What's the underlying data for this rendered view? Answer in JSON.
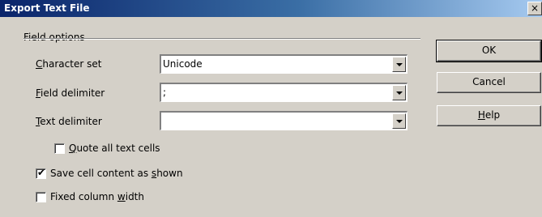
{
  "window": {
    "title": "Export Text File",
    "close_glyph": "×"
  },
  "field_options": {
    "legend": "Field options",
    "character_set": {
      "label_mnemonic": "C",
      "label_rest": "haracter set",
      "value": "Unicode"
    },
    "field_delimiter": {
      "label_mnemonic": "F",
      "label_rest": "ield delimiter",
      "value": ";"
    },
    "text_delimiter": {
      "label_mnemonic": "T",
      "label_rest": "ext delimiter",
      "value": ""
    }
  },
  "checkboxes": {
    "quote_all": {
      "label_mnemonic": "Q",
      "label_rest": "uote all text cells",
      "checked": false
    },
    "save_as_shown": {
      "label_pre": "Save cell content as ",
      "label_mnemonic": "s",
      "label_rest": "hown",
      "checked": true
    },
    "fixed_width": {
      "label_pre": "Fixed column ",
      "label_mnemonic": "w",
      "label_rest": "idth",
      "checked": false
    },
    "check_glyph": "✔"
  },
  "buttons": {
    "ok": "OK",
    "cancel": "Cancel",
    "help_mnemonic": "H",
    "help_rest": "elp"
  }
}
